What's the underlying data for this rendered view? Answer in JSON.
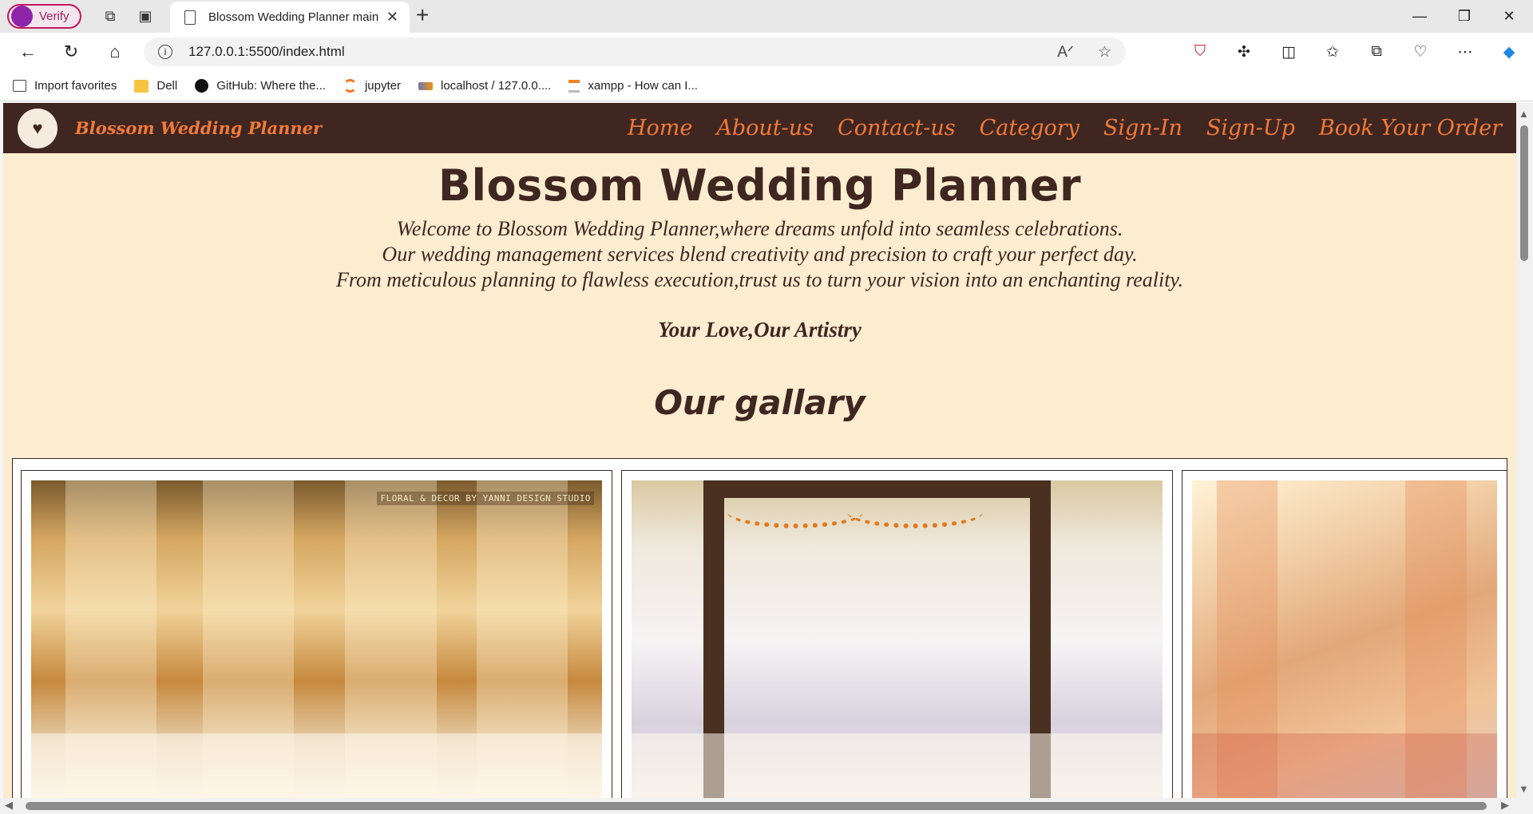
{
  "browser": {
    "profile_label": "Verify",
    "tab_title": "Blossom Wedding Planner main",
    "url": "127.0.0.1:5500/index.html",
    "favorites": [
      {
        "label": "Import favorites",
        "icon": "import-icon"
      },
      {
        "label": "Dell",
        "icon": "folder-icon"
      },
      {
        "label": "GitHub: Where the...",
        "icon": "github-icon"
      },
      {
        "label": "jupyter",
        "icon": "jupyter-icon"
      },
      {
        "label": "localhost / 127.0.0....",
        "icon": "phpmyadmin-icon"
      },
      {
        "label": "xampp - How can I...",
        "icon": "stackoverflow-icon"
      }
    ]
  },
  "site": {
    "brand": "Blossom Wedding Planner",
    "menu": [
      "Home",
      "About-us",
      "Contact-us",
      "Category",
      "Sign-In",
      "Sign-Up",
      "Book Your Order"
    ],
    "hero_title": "Blossom Wedding Planner",
    "intro_lines": [
      "Welcome to Blossom Wedding Planner,where dreams unfold into seamless celebrations.",
      "Our wedding management services blend creativity and precision to craft your perfect day.",
      "From meticulous planning to flawless execution,trust us to turn your vision into an enchanting reality."
    ],
    "tagline": "Your Love,Our Artistry",
    "gallery_title": "Our gallary",
    "gallery_watermark": "FLORAL & DECOR BY YANNI DESIGN STUDIO"
  },
  "colors": {
    "nav_bg": "#3f2620",
    "accent": "#f07a3a",
    "page_bg": "#fcecd0",
    "text": "#3f2620"
  }
}
